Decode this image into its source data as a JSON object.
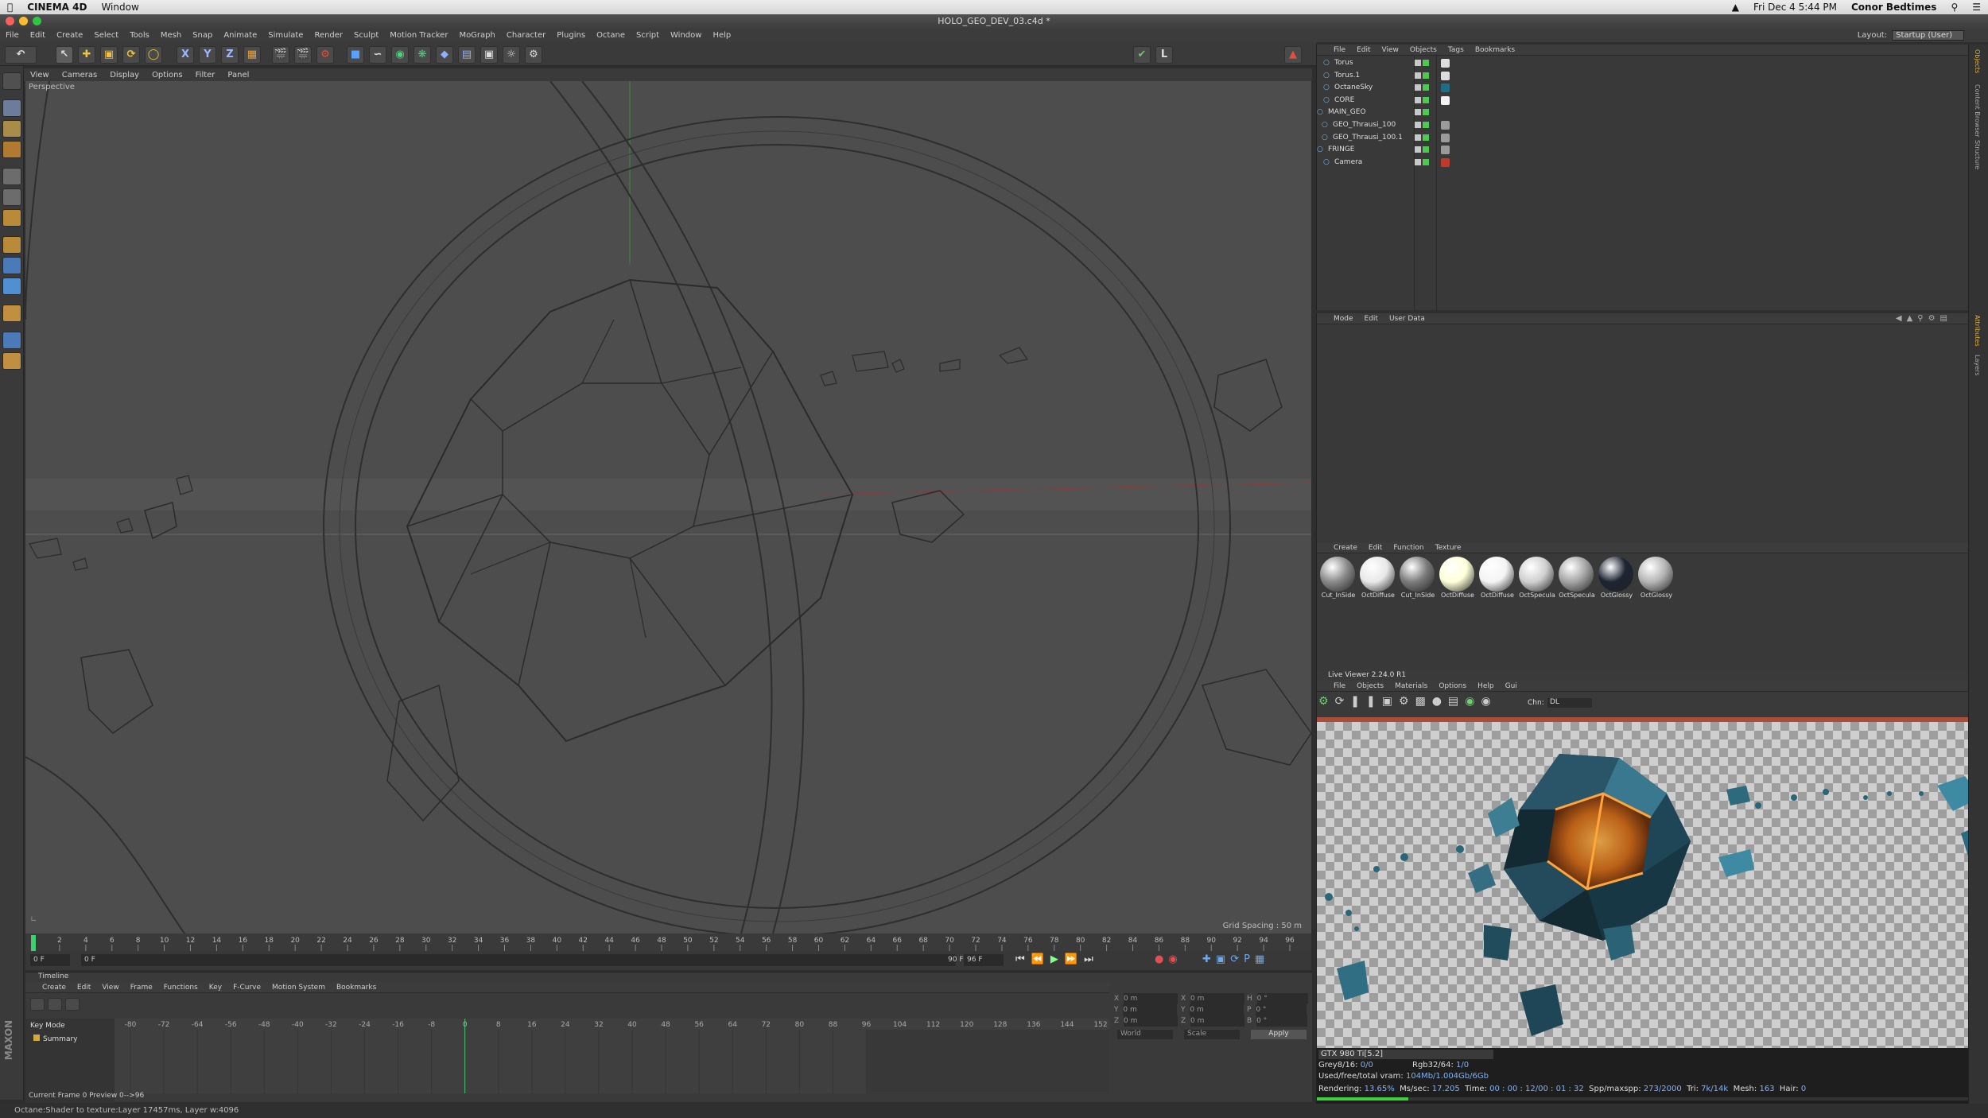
{
  "mac": {
    "app": "CINEMA 4D",
    "menu": "Window",
    "datetime": "Fri Dec 4  5:44 PM",
    "user": "Conor Bedtimes"
  },
  "window": {
    "title": "HOLO_GEO_DEV_03.c4d *"
  },
  "menubar": [
    "File",
    "Edit",
    "Create",
    "Select",
    "Tools",
    "Mesh",
    "Snap",
    "Animate",
    "Simulate",
    "Render",
    "Sculpt",
    "Motion Tracker",
    "MoGraph",
    "Character",
    "Plugins",
    "Octane",
    "Script",
    "Window",
    "Help"
  ],
  "layout": {
    "label": "Layout:",
    "value": "Startup (User)"
  },
  "viewport": {
    "menu": [
      "View",
      "Cameras",
      "Display",
      "Options",
      "Filter",
      "Panel"
    ],
    "label": "Perspective",
    "grid_spacing": "Grid Spacing : 50 m"
  },
  "ruler_ticks": [
    "0",
    "2",
    "4",
    "6",
    "8",
    "10",
    "12",
    "14",
    "16",
    "18",
    "20",
    "22",
    "24",
    "26",
    "28",
    "30",
    "32",
    "34",
    "36",
    "38",
    "40",
    "42",
    "44",
    "46",
    "48",
    "50",
    "52",
    "54",
    "56",
    "58",
    "60",
    "62",
    "64",
    "66",
    "68",
    "70",
    "72",
    "74",
    "76",
    "78",
    "80",
    "82",
    "84",
    "86",
    "88",
    "90",
    "92",
    "94",
    "96"
  ],
  "frames": {
    "current": "0 F",
    "start": "0 F",
    "end": "96 F",
    "end2": "90 F",
    "field": "0 F"
  },
  "timeline": {
    "title": "Timeline",
    "menu": [
      "Create",
      "Edit",
      "View",
      "Frame",
      "Functions",
      "Key",
      "F-Curve",
      "Motion System",
      "Bookmarks"
    ],
    "mode": "Key Mode",
    "summary": "Summary",
    "ticks": [
      "-80",
      "-72",
      "-64",
      "-56",
      "-48",
      "-40",
      "-32",
      "-24",
      "-16",
      "-8",
      "0",
      "8",
      "16",
      "24",
      "32",
      "40",
      "48",
      "56",
      "64",
      "72",
      "80",
      "88",
      "96",
      "104",
      "112",
      "120",
      "128",
      "136",
      "144",
      "152"
    ],
    "current_frame": "Current Frame  0  Preview  0-->96"
  },
  "coords": {
    "x": "X",
    "y": "Y",
    "z": "Z",
    "h": "H",
    "p": "P",
    "b": "B",
    "val_m": "0 m",
    "val_deg": "0 °",
    "world": "World",
    "scale": "Scale",
    "apply": "Apply"
  },
  "status": "Octane:Shader to texture:Layer  17457ms, Layer w:4096",
  "objects": {
    "menu": [
      "File",
      "Edit",
      "View",
      "Objects",
      "Tags",
      "Bookmarks"
    ],
    "items": [
      {
        "name": "Torus",
        "tag": "#dddddd"
      },
      {
        "name": "Torus.1",
        "tag": "#dddddd"
      },
      {
        "name": "OctaneSky",
        "tag": "#1e6e8a"
      },
      {
        "name": "CORE",
        "tag": "#f2f2f2"
      },
      {
        "name": "MAIN_GEO",
        "tag": ""
      },
      {
        "name": "GEO_Thrausi_100",
        "tag": "#9a9a9a"
      },
      {
        "name": "GEO_Thrausi_100.1",
        "tag": "#9a9a9a"
      },
      {
        "name": "FRINGE",
        "tag": "#9a9a9a"
      },
      {
        "name": "Camera",
        "tag": "#c0392b"
      }
    ]
  },
  "attributes": {
    "menu": [
      "Mode",
      "Edit",
      "User Data"
    ]
  },
  "materials": {
    "menu": [
      "Create",
      "Edit",
      "Function",
      "Texture"
    ],
    "items": [
      {
        "name": "Cut_InSide",
        "color": "#8a8a8a"
      },
      {
        "name": "OctDiffuse",
        "color": "#e8e8e8"
      },
      {
        "name": "Cut_InSide",
        "color": "#7c7c7c"
      },
      {
        "name": "OctDiffuse",
        "color": "#ffffd8"
      },
      {
        "name": "OctDiffuse",
        "color": "#f4f4f4"
      },
      {
        "name": "OctSpecula",
        "color": "#d0d0d0"
      },
      {
        "name": "OctSpecula",
        "color": "#a5a5a5"
      },
      {
        "name": "OctGlossy",
        "color": "#1d2433"
      },
      {
        "name": "OctGlossy",
        "color": "#b5b5b5"
      }
    ]
  },
  "liveviewer": {
    "title": "Live Viewer 2.24.0 R1",
    "menu": [
      "File",
      "Objects",
      "Materials",
      "Options",
      "Help",
      "Gui"
    ],
    "chn_label": "Chn:",
    "chn_value": "DL",
    "gpu": "GTX 980 Ti[5.2]",
    "grey": "Grey8/16:",
    "grey_val": "0/0",
    "rgb": "Rgb32/64:",
    "rgb_val": "1/0",
    "vram": "Used/free/total vram:",
    "vram_val": "104Mb/1.004Gb/6Gb",
    "rendering": "Rendering:",
    "rendering_val": "13.65%",
    "ms": "Ms/sec:",
    "ms_val": "17.205",
    "time": "Time:",
    "time_val": "00 : 00 : 12/00 : 01 : 32",
    "spp": "Spp/maxspp:",
    "spp_val": "273/2000",
    "tri": "Tri:",
    "tri_val": "7k/14k",
    "mesh": "Mesh:",
    "mesh_val": "163",
    "hair": "Hair:",
    "hair_val": "0",
    "progress": 0.1365
  },
  "side_tabs": [
    "Objects",
    "Content Browser",
    "Structure",
    "Attributes",
    "Layers"
  ],
  "icons": [
    "apple-icon",
    "undo-icon",
    "move-icon",
    "scale-icon",
    "rotate-icon",
    "render-icon",
    "camera-icon",
    "light-icon",
    "play-icon",
    "record-icon"
  ]
}
